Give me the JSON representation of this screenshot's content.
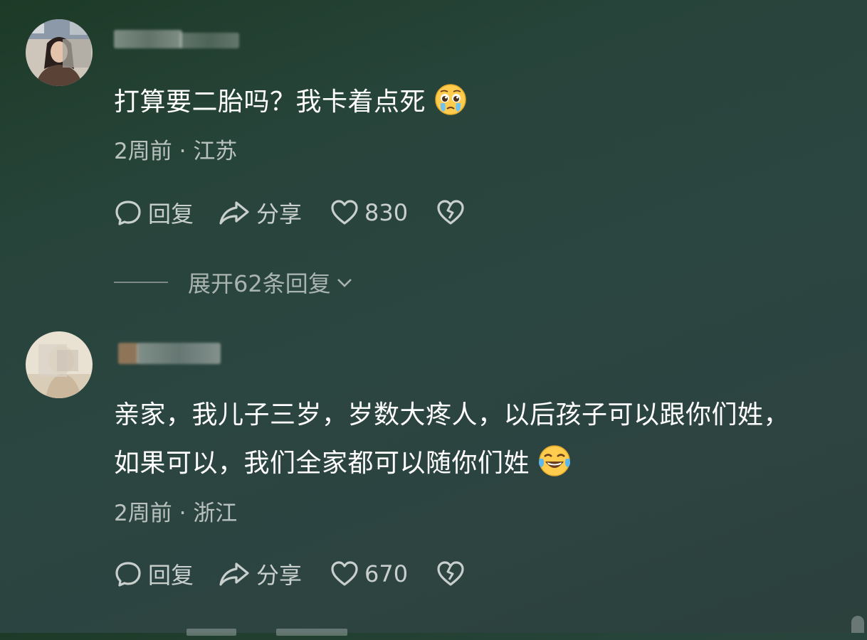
{
  "comments": [
    {
      "text_lines": [
        "打算要二胎吗？我卡着点死"
      ],
      "emoji": "crying-pleading-face",
      "time": "2周前",
      "separator": "·",
      "location": "江苏",
      "reply_label": "回复",
      "share_label": "分享",
      "like_count": "830",
      "expand_label": "展开62条回复"
    },
    {
      "text_lines": [
        "亲家，我儿子三岁，岁数大疼人，以后孩子可以跟你们姓，",
        "如果可以，我们全家都可以随你们姓"
      ],
      "emoji": "tears-of-joy-face",
      "time": "2周前",
      "separator": "·",
      "location": "浙江",
      "reply_label": "回复",
      "share_label": "分享",
      "like_count": "670"
    }
  ],
  "icons": {
    "reply": "comment-bubble-icon",
    "share": "share-arrow-icon",
    "like": "heart-icon",
    "dislike": "broken-heart-icon",
    "expand": "chevron-down-icon"
  },
  "colors": {
    "text": "#ffffff",
    "meta": "#b9c2bf",
    "action": "#c8cfcc",
    "expand": "#a9b3b0"
  }
}
